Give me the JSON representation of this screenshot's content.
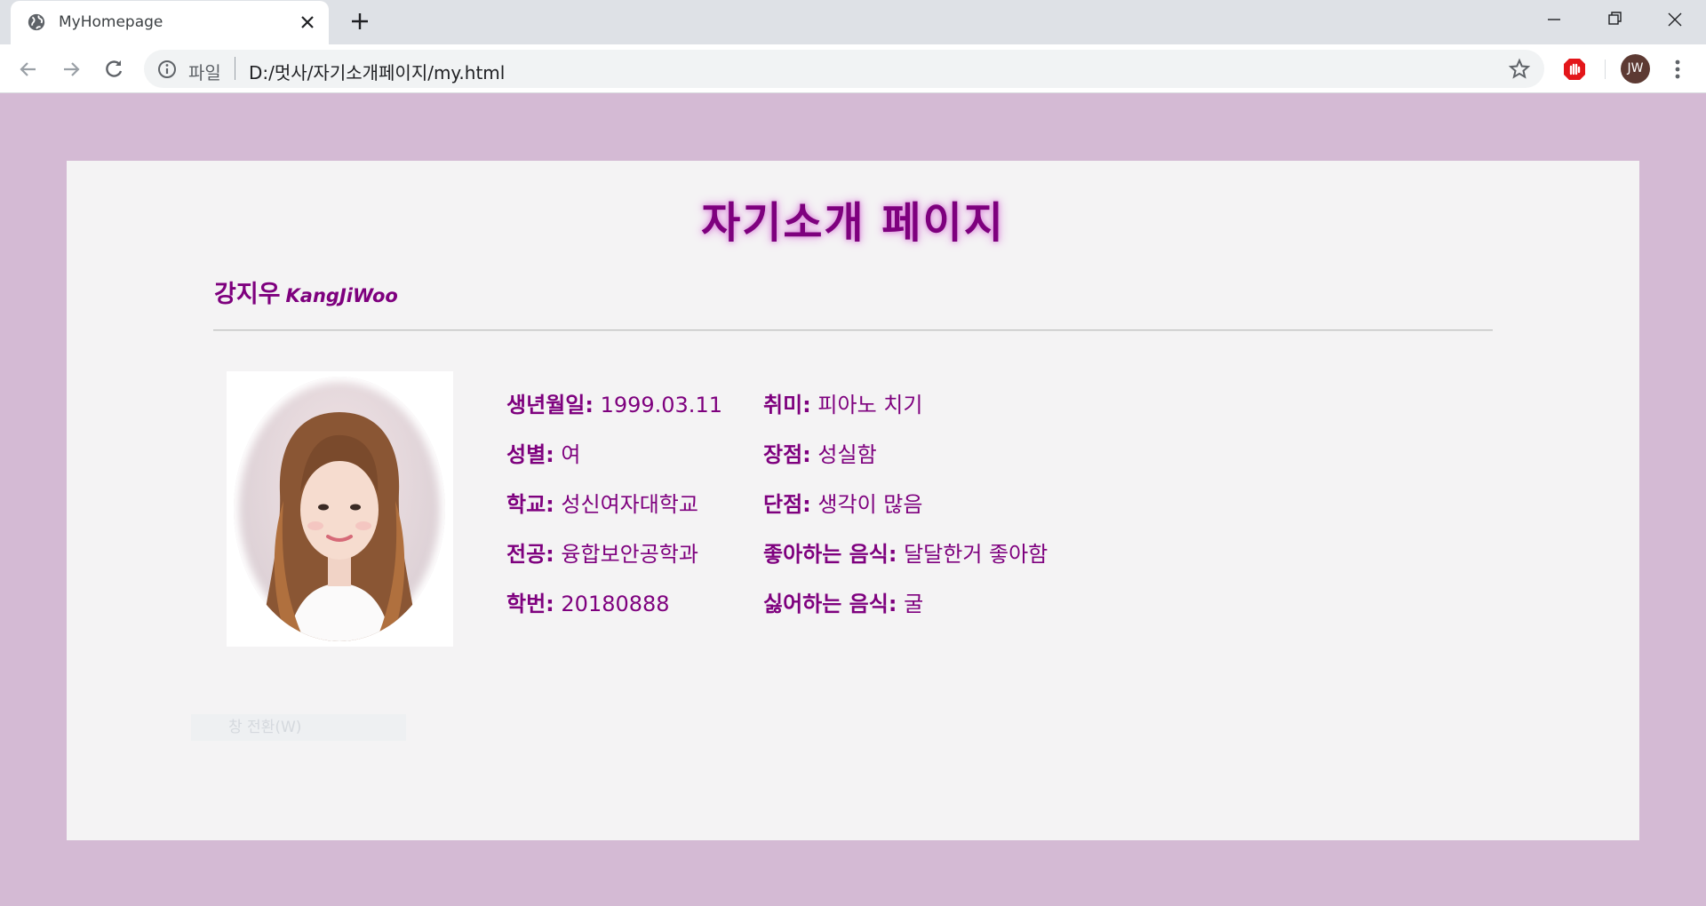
{
  "browser": {
    "tab_title": "MyHomepage",
    "url_prefix": "파일",
    "url": "D:/멋사/자기소개페이지/my.html",
    "profile_initials": "JW"
  },
  "page": {
    "title": "자기소개 페이지",
    "name_ko": "강지우",
    "name_en": "KangJiWoo",
    "left_info": [
      {
        "key": "생년월일:",
        "value": "1999.03.11"
      },
      {
        "key": "성별:",
        "value": "여"
      },
      {
        "key": "학교:",
        "value": "성신여자대학교"
      },
      {
        "key": "전공:",
        "value": "융합보안공학과"
      },
      {
        "key": "학번:",
        "value": "20180888"
      }
    ],
    "right_info": [
      {
        "key": "취미:",
        "value": "피아노 치기"
      },
      {
        "key": "장점:",
        "value": "성실함"
      },
      {
        "key": "단점:",
        "value": "생각이 많음"
      },
      {
        "key": "좋아하는 음식:",
        "value": "달달한거 좋아함"
      },
      {
        "key": "싫어하는 음식:",
        "value": "굴"
      }
    ],
    "faded_button": "창 전환(W)"
  },
  "colors": {
    "page_bg": "#d4bad4",
    "card_bg": "#f4f3f4",
    "accent": "#7e007e",
    "title_glow": "#e08fe0"
  }
}
